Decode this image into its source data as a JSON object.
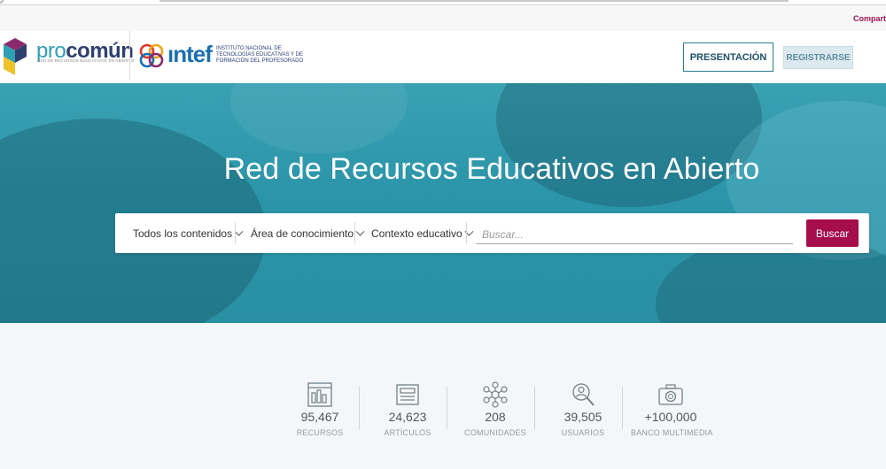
{
  "browser": {
    "share_label": "Compartir"
  },
  "header": {
    "procomun": {
      "name_prefix": "pro",
      "name_suffix": "común",
      "tagline": "RED DE RECURSOS EDUCATIVOS EN ABIERTO"
    },
    "intef": {
      "name": "ıntef",
      "description_lines": [
        "INSTITUTO NACIONAL DE",
        "TECNOLOGÍAS EDUCATIVAS Y DE",
        "FORMACIÓN DEL PROFESORADO"
      ]
    },
    "presentation_label": "PRESENTACIÓN",
    "register_label": "REGISTRARSE"
  },
  "hero": {
    "title": "Red de Recursos Educativos en Abierto",
    "filters": [
      {
        "label": "Todos los contenidos"
      },
      {
        "label": "Área de conocimiento"
      },
      {
        "label": "Contexto educativo"
      }
    ],
    "search": {
      "placeholder": "Buscar...",
      "value": ""
    },
    "search_button_label": "Buscar"
  },
  "stats": [
    {
      "icon": "resources-icon",
      "value": "95,467",
      "label": "RECURSOS"
    },
    {
      "icon": "articles-icon",
      "value": "24,623",
      "label": "ARTÍCULOS"
    },
    {
      "icon": "communities-icon",
      "value": "208",
      "label": "COMUNIDADES"
    },
    {
      "icon": "users-icon",
      "value": "39,505",
      "label": "USUARIOS"
    },
    {
      "icon": "camera-icon",
      "value": "+100,000",
      "label": "BANCO MULTIMEDIA"
    }
  ],
  "colors": {
    "accent": "#a50d4b",
    "hero": "#2c95a9",
    "navy": "#2f3f6f"
  }
}
